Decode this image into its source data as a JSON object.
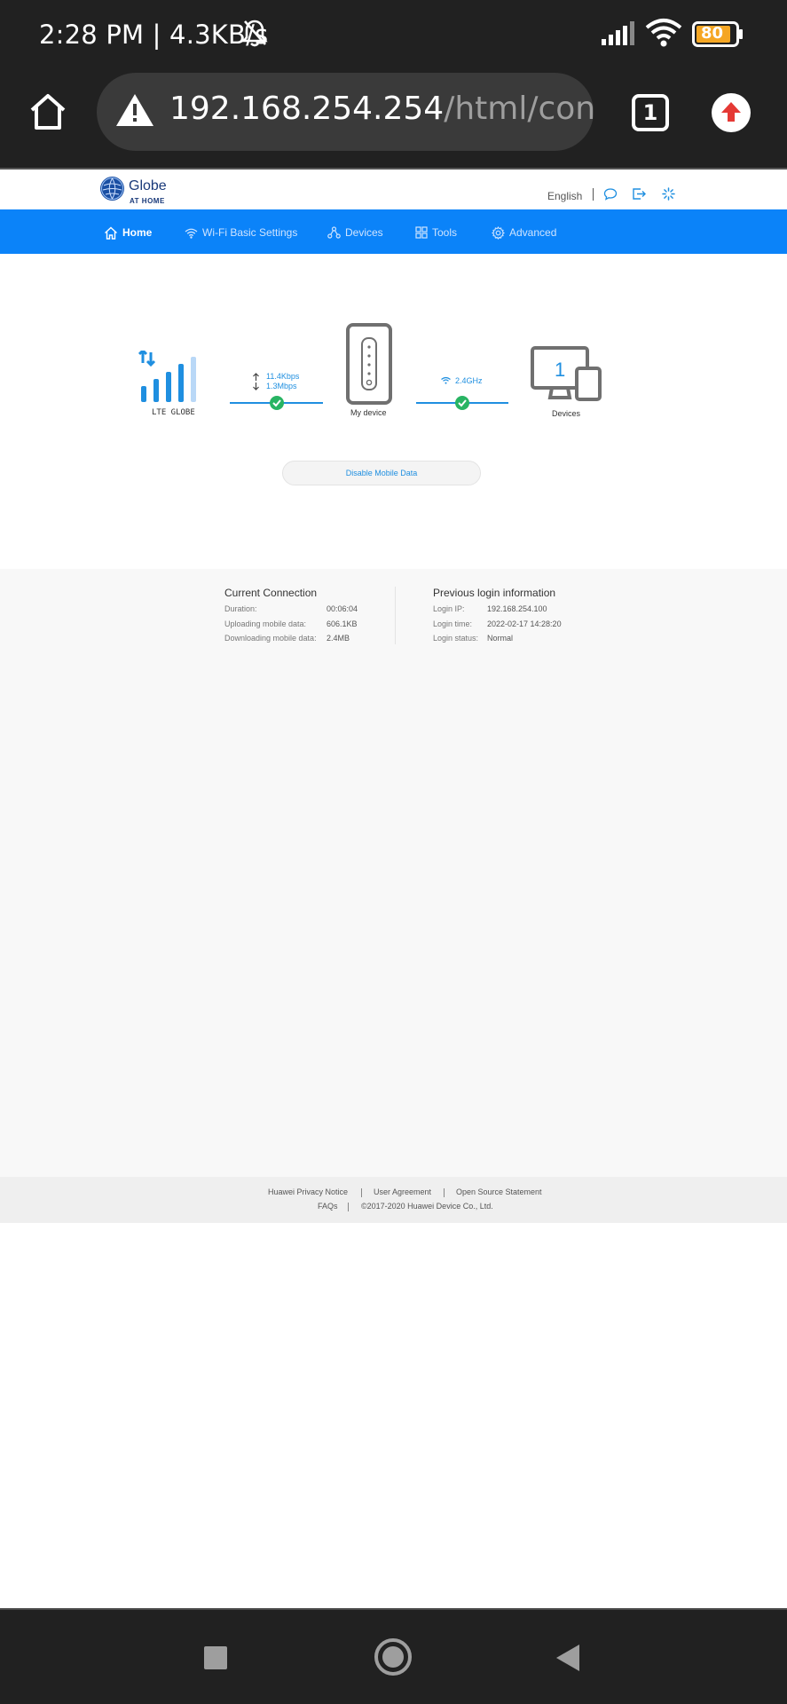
{
  "status_bar": {
    "time_speed": "2:28 PM | 4.3KB/s",
    "battery_level": "80"
  },
  "browser": {
    "url_host": "192.168.254.254",
    "url_path": "/html/conte",
    "tab_count": "1"
  },
  "header": {
    "logo_name": "Globe",
    "logo_sub": "AT HOME",
    "language": "English"
  },
  "nav": {
    "items": [
      {
        "label": "Home",
        "icon": "home-icon",
        "active": true
      },
      {
        "label": "Wi-Fi Basic Settings",
        "icon": "wifi-icon",
        "active": false
      },
      {
        "label": "Devices",
        "icon": "devices-icon",
        "active": false
      },
      {
        "label": "Tools",
        "icon": "tools-icon",
        "active": false
      },
      {
        "label": "Advanced",
        "icon": "gear-icon",
        "active": false
      }
    ]
  },
  "topology": {
    "network_label": "LTE GLOBE",
    "upload_rate": "11.4Kbps",
    "download_rate": "1.3Mbps",
    "device_label": "My device",
    "wifi_band": "2.4GHz",
    "devices_count": "1",
    "devices_label": "Devices",
    "disable_button": "Disable Mobile Data"
  },
  "current_connection": {
    "title": "Current Connection",
    "rows": [
      {
        "key": "Duration:",
        "value": "00:06:04"
      },
      {
        "key": "Uploading mobile data:",
        "value": "606.1KB"
      },
      {
        "key": "Downloading mobile data:",
        "value": "2.4MB"
      }
    ]
  },
  "previous_login": {
    "title": "Previous login information",
    "rows": [
      {
        "key": "Login IP:",
        "value": "192.168.254.100"
      },
      {
        "key": "Login time:",
        "value": "2022-02-17 14:28:20"
      },
      {
        "key": "Login status:",
        "value": "Normal"
      }
    ]
  },
  "footer": {
    "privacy": "Huawei Privacy Notice",
    "agreement": "User Agreement",
    "open_source": "Open Source Statement",
    "faqs": "FAQs",
    "copyright": "©2017-2020 Huawei Device Co., Ltd."
  },
  "colors": {
    "nav_blue": "#0b83f9",
    "link_blue": "#1f8fe0",
    "ok_green": "#28b463",
    "chrome_dark": "#212121"
  }
}
